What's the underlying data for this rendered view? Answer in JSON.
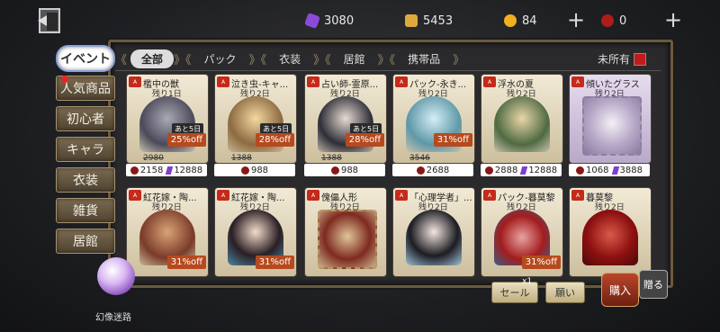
{
  "currencies": {
    "purple": "3080",
    "puzzle": "5453",
    "coin": "84",
    "red": "0"
  },
  "filters": {
    "tabs": [
      "全部",
      "パック",
      "衣装",
      "居館",
      "携帯品"
    ],
    "unowned_label": "未所有"
  },
  "sidebar": {
    "items": [
      "イベント",
      "人気商品",
      "初心者",
      "キャラ",
      "衣装",
      "雑貨",
      "居館"
    ]
  },
  "cards_row1": [
    {
      "name": "檻中の獣",
      "date": "残り1日",
      "discount": "25%off",
      "left": "あと5日",
      "orig": "2980",
      "p1": "2158",
      "p2": "12888"
    },
    {
      "name": "泣き虫-キャ...",
      "date": "残り2日",
      "discount": "28%off",
      "left": "あと5日",
      "orig": "1388",
      "p1": "988",
      "p2": ""
    },
    {
      "name": "占い師-霊原...",
      "date": "残り2日",
      "discount": "28%off",
      "left": "あと5日",
      "orig": "1388",
      "p1": "988",
      "p2": ""
    },
    {
      "name": "パック-永き...",
      "date": "残り2日",
      "discount": "31%off",
      "left": "",
      "orig": "3546",
      "p1": "2688",
      "p2": ""
    },
    {
      "name": "浮水の夏",
      "date": "残り2日",
      "discount": "",
      "left": "",
      "orig": "",
      "p1": "2888",
      "p2": "12888"
    },
    {
      "name": "傾いたグラス",
      "date": "残り2日",
      "discount": "",
      "left": "",
      "orig": "",
      "p1": "1068",
      "p2": "3888"
    }
  ],
  "cards_row2": [
    {
      "name": "紅花嫁・陶...",
      "date": "残り2日",
      "discount": "31%off"
    },
    {
      "name": "紅花嫁・陶...",
      "date": "残り2日",
      "discount": "31%off"
    },
    {
      "name": "傀儡人形",
      "date": "残り2日",
      "discount": ""
    },
    {
      "name": "「心理学者」...",
      "date": "残り2日",
      "discount": ""
    },
    {
      "name": "パック-暮莫黎",
      "date": "残り2日",
      "discount": "31%off"
    },
    {
      "name": "暮莫黎",
      "date": "残り2日",
      "discount": ""
    }
  ],
  "bottom": {
    "sale_label": "セール",
    "sale_count": "x1",
    "wish_label": "願い",
    "buy_label": "購入",
    "gift_label": "贈る",
    "orb_label": "幻像迷路"
  },
  "colors": {
    "accent": "#6b5a3e",
    "discount": "#b64a1e",
    "red_currency": "#8a1717",
    "purple_currency": "#7e3fd0"
  }
}
